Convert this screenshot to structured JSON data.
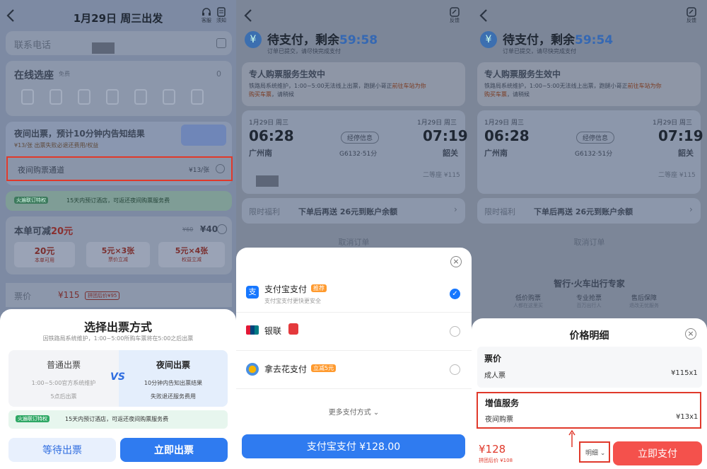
{
  "panel1": {
    "header": {
      "title": "1月29日 周三出发",
      "service_label": "客服",
      "notice_label": "须知"
    },
    "contact": {
      "label": "联系电话"
    },
    "seat": {
      "title": "在线选座",
      "badge": "免费",
      "count": "0"
    },
    "night": {
      "title": "夜间出票，预计10分钟内告知结果",
      "sub": "¥13/张 出票失败必退还费用/权益",
      "channel_label": "夜间购票通道",
      "channel_price": "¥13/张"
    },
    "hotel_banner": {
      "tag": "火遍联订特权",
      "text": "15天内预订酒店，可返还夜间购票服务费"
    },
    "discount": {
      "title_prefix": "本单可减",
      "title_amount": "20元",
      "old_price": "¥60",
      "price": "¥40",
      "coupons": [
        {
          "value": "20元",
          "desc": "本单可用"
        },
        {
          "value": "5元×3张",
          "desc": "票价立减"
        },
        {
          "value": "5元×4张",
          "desc": "权益立减"
        }
      ]
    },
    "ticket_price": {
      "label": "票价",
      "value": "¥115",
      "tag": "拼团后价¥95"
    },
    "sheet": {
      "title": "选择出票方式",
      "subtitle": "因铁路局系统维护，1:00~5:00所购车票将在5:00之后出票",
      "normal": {
        "title": "普通出票",
        "line1": "1:00~5:00官方系统维护",
        "line2": "5点后出票"
      },
      "vs": "VS",
      "night": {
        "title": "夜间出票",
        "line1": "10分钟内告知出票结果",
        "line2": "失败退还服务费用"
      },
      "banner_tag": "火遍联订特权",
      "banner_text": "15天内预订酒店，可返还夜间购票服务费",
      "wait_button": "等待出票",
      "now_button": "立即出票"
    }
  },
  "panel2": {
    "feedback_label": "反馈",
    "status": {
      "title": "待支付，剩余",
      "timer": "59:58",
      "sub": "订单已提交，请尽快完成支付"
    },
    "service": {
      "title": "专人购票服务生效中",
      "line1_a": "铁路局系统维护，1:00~5:00无法线上出票，跑腿小哥正",
      "line1_b": "前往车站为你",
      "line2_a": "购买车票",
      "line2_b": "，请稍候"
    },
    "trip": {
      "dep_date": "1月29日 周三",
      "dep_time": "06:28",
      "dep_station": "广州南",
      "arr_date": "1月29日 周三",
      "arr_time": "07:19",
      "arr_station": "韶关",
      "via_label": "经停信息",
      "train": "G6132·51分",
      "seat_price": "二等座 ¥115"
    },
    "perk": {
      "label": "限时福利",
      "text": "下单后再送 26元到账户余额"
    },
    "cancel_label": "取消订单",
    "payment_sheet": {
      "methods": [
        {
          "name": "支付宝支付",
          "tag": "推荐",
          "sub": "支付宝支付更快更安全",
          "selected": true
        },
        {
          "name": "银联",
          "tag": "",
          "sub": "",
          "selected": false
        },
        {
          "name": "拿去花支付",
          "tag": "立减5元",
          "sub": "",
          "selected": false
        }
      ],
      "more_label": "更多支付方式",
      "pay_button": "支付宝支付 ¥128.00"
    }
  },
  "panel3": {
    "feedback_label": "反馈",
    "status": {
      "title": "待支付，剩余",
      "timer": "59:54",
      "sub": "订单已提交，请尽快完成支付"
    },
    "service": {
      "title": "专人购票服务生效中",
      "line1_a": "铁路局系统维护，1:00~5:00无法线上出票，跑腿小哥正",
      "line1_b": "前往车站为你",
      "line2_a": "购买车票",
      "line2_b": "，请稍候"
    },
    "trip": {
      "dep_date": "1月29日 周三",
      "dep_time": "06:28",
      "dep_station": "广州南",
      "arr_date": "1月29日 周三",
      "arr_time": "07:19",
      "arr_station": "韶关",
      "via_label": "经停信息",
      "train": "G6132·51分",
      "seat_price": "二等座 ¥115"
    },
    "perk": {
      "label": "限时福利",
      "text": "下单后再送 26元到账户余额"
    },
    "cancel_label": "取消订单",
    "brand": {
      "title": "智行·火车出行专家",
      "features": [
        {
          "title": "低价购票",
          "sub": "人都在这里买"
        },
        {
          "title": "专业抢票",
          "sub": "百万出行人"
        },
        {
          "title": "售后保障",
          "sub": "退改无忧服务"
        }
      ]
    },
    "price_sheet": {
      "title": "价格明细",
      "ticket_section": "票价",
      "ticket_item": "成人票",
      "ticket_value": "¥115x1",
      "vas_section": "增值服务",
      "vas_item": "夜间购票",
      "vas_value": "¥13x1"
    },
    "footer": {
      "total": "¥128",
      "group_price": "拼团后价 ¥108",
      "detail_label": "明细",
      "pay_button": "立即支付"
    }
  }
}
